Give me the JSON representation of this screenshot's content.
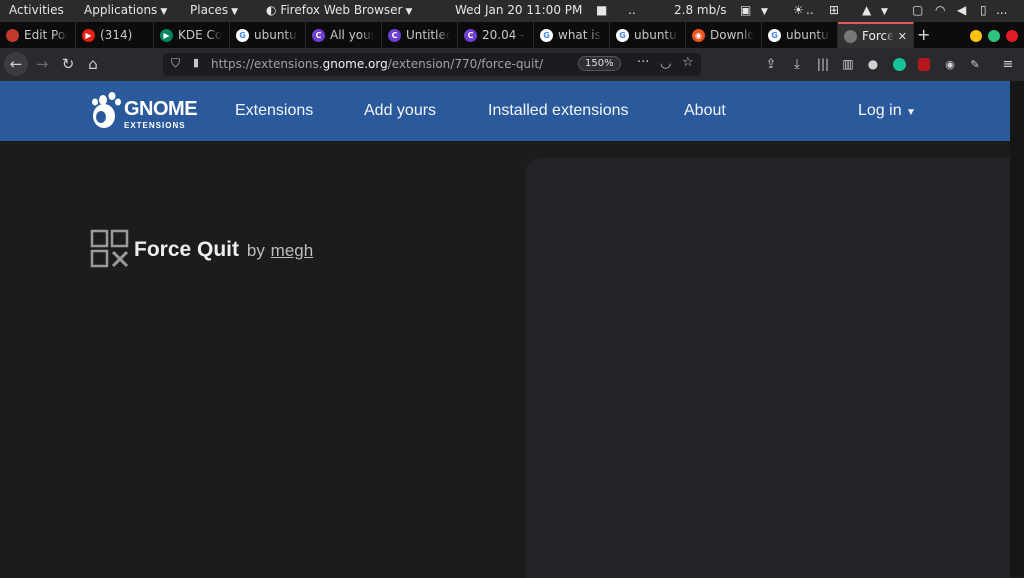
{
  "topbar": {
    "activities": "Activities",
    "applications": "Applications",
    "places": "Places",
    "app_name": "Firefox Web Browser",
    "clock": "Wed Jan 20  11:00 PM",
    "ellipsis": "..",
    "net_speed": "2.8 mb/s",
    "more": "..."
  },
  "tabs": [
    {
      "label": "Edit Post",
      "fav_color": "#c0392b",
      "fav_glyph": ""
    },
    {
      "label": "(314)",
      "fav_color": "#e62117",
      "fav_glyph": "▶"
    },
    {
      "label": "KDE Connect",
      "fav_color": "#01875f",
      "fav_glyph": "▶"
    },
    {
      "label": "ubuntu",
      "fav_color": "#ffffff",
      "fav_glyph": "G"
    },
    {
      "label": "All your",
      "fav_color": "#6e3fd1",
      "fav_glyph": "C"
    },
    {
      "label": "Untitled",
      "fav_color": "#6e3fd1",
      "fav_glyph": "C"
    },
    {
      "label": "20.04 -",
      "fav_color": "#6e3fd1",
      "fav_glyph": "C"
    },
    {
      "label": "what is",
      "fav_color": "#ffffff",
      "fav_glyph": "G"
    },
    {
      "label": "ubuntu",
      "fav_color": "#ffffff",
      "fav_glyph": "G"
    },
    {
      "label": "Download",
      "fav_color": "#e95420",
      "fav_glyph": "◉"
    },
    {
      "label": "ubuntu",
      "fav_color": "#ffffff",
      "fav_glyph": "G"
    },
    {
      "label": "Force Quit",
      "fav_color": "#777777",
      "fav_glyph": ""
    }
  ],
  "navbar": {
    "url_prefix": "https://extensions.",
    "url_domain": "gnome.org",
    "url_path": "/extension/770/force-quit/",
    "zoom": "150%"
  },
  "header": {
    "logo_text": "GNOME",
    "logo_sub": "EXTENSIONS",
    "nav": [
      "Extensions",
      "Add yours",
      "Installed extensions",
      "About"
    ],
    "login": "Log in"
  },
  "extension": {
    "name": "Force Quit",
    "by": "by",
    "author": "megh"
  },
  "colors": {
    "header_bg": "#2b5a9c",
    "page_bg": "#1c1c1d",
    "active_tab_accent": "#e05a5a"
  }
}
